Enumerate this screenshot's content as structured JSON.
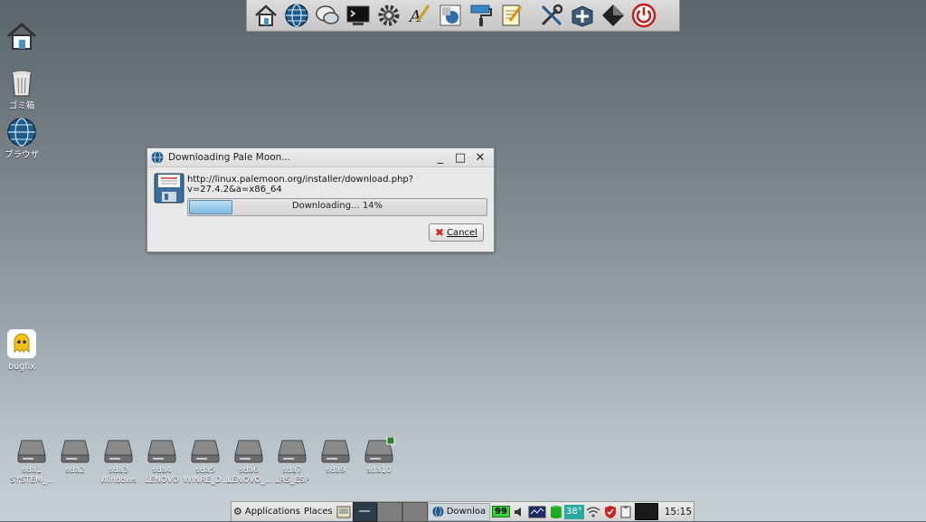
{
  "launcher": {
    "icons": [
      "home-icon",
      "browser-globe-icon",
      "chat-icon",
      "terminal-icon",
      "settings-gear-icon",
      "paint-brush-icon",
      "drawing-icon",
      "paint-roller-icon",
      "text-editor-icon",
      "tools-icon",
      "package-icon",
      "diamond-icon",
      "power-icon"
    ]
  },
  "desktop": {
    "home_label": "",
    "trash_label": "ゴミ箱",
    "browser_label": "ブラウザ",
    "bugfix_label": "bugfix"
  },
  "drives": [
    {
      "name": "sda1",
      "sub": "SYSTEM_..."
    },
    {
      "name": "sda2",
      "sub": ""
    },
    {
      "name": "sda3",
      "sub": "Windows"
    },
    {
      "name": "sda4",
      "sub": "LENOVO"
    },
    {
      "name": "sda5",
      "sub": "WINRE_D..."
    },
    {
      "name": "sda6",
      "sub": "LENOVO_..."
    },
    {
      "name": "sda7",
      "sub": "LRS_ESP"
    },
    {
      "name": "sda9",
      "sub": ""
    },
    {
      "name": "sda10",
      "sub": ""
    }
  ],
  "dialog": {
    "title": "Downloading Pale Moon...",
    "minimize": "_",
    "maximize": "□",
    "close": "✕",
    "url_line1": "http://linux.palemoon.org/installer/download.php?",
    "url_line2": "v=27.4.2&a=x86_64",
    "progress_text": "Downloading... 14%",
    "progress_fraction": 0.14,
    "cancel_label": "Cancel"
  },
  "taskbar": {
    "applications": "Applications",
    "places": "Places",
    "task_label": "Downloa",
    "battery": "99",
    "temperature": "38°",
    "clock": "15:15"
  },
  "colors": {
    "accent_blue": "#1e5a8a",
    "close_red": "#d21"
  }
}
